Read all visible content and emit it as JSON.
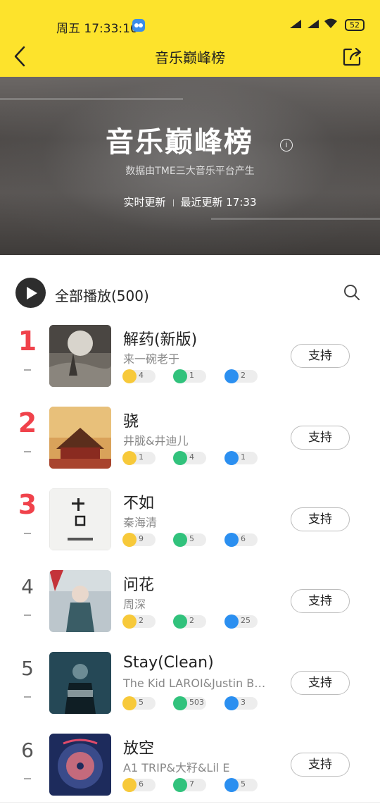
{
  "status": {
    "day": "周五",
    "time": "17:33:16",
    "battery": "52"
  },
  "header": {
    "title": "音乐巅峰榜"
  },
  "banner": {
    "title": "音乐巅峰榜",
    "subtitle": "数据由TME三大音乐平台产生",
    "realtime": "实时更新",
    "last_update": "最近更新 17:33"
  },
  "playall": {
    "label": "全部播放(500)"
  },
  "support_label": "支持",
  "colors": {
    "header_bg": "#fde32c",
    "top_rank": "#f0424b"
  },
  "songs": [
    {
      "rank": "1",
      "title": "解药(新版)",
      "artist": "来一碗老于",
      "kuwo": "4",
      "qq": "1",
      "kugou": "2"
    },
    {
      "rank": "2",
      "title": "骁",
      "artist": "井胧&井迪儿",
      "kuwo": "1",
      "qq": "4",
      "kugou": "1"
    },
    {
      "rank": "3",
      "title": "不如",
      "artist": "秦海清",
      "kuwo": "9",
      "qq": "5",
      "kugou": "6"
    },
    {
      "rank": "4",
      "title": "问花",
      "artist": "周深",
      "kuwo": "2",
      "qq": "2",
      "kugou": "25"
    },
    {
      "rank": "5",
      "title": "Stay(Clean)",
      "artist": "The Kid LAROI&Justin B…",
      "kuwo": "5",
      "qq": "503",
      "kugou": "3"
    },
    {
      "rank": "6",
      "title": "放空",
      "artist": "A1 TRIP&大籽&Lil E",
      "kuwo": "6",
      "qq": "7",
      "kugou": "5"
    }
  ]
}
